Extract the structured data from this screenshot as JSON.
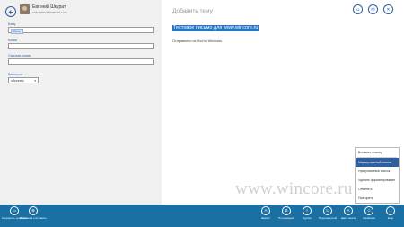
{
  "header": {
    "user_name": "Евгений Шкурат",
    "user_email": "shkuratev@hotmail.com"
  },
  "fields": {
    "to_label": "Кому",
    "to_chip": "Wins",
    "cc_label": "Копия",
    "bcc_label": "Скрытая копия",
    "priority_label": "Важность",
    "priority_value": "обычная"
  },
  "message": {
    "subject_placeholder": "Добавить тему",
    "body_text": "Тестовое письмо для www.wincore.ru",
    "signature": "Отправлено из Почты Windows"
  },
  "top_actions": {
    "attach_icon": "emoji-icon",
    "send_icon": "send-icon",
    "delete_icon": "delete-icon",
    "attach_glyph": "☺",
    "send_glyph": "✉",
    "delete_glyph": "✕"
  },
  "context_menu": {
    "items": [
      "Вставить ссылку",
      "Маркированный список",
      "Нумерованный список",
      "Удалить форматирование",
      "Отменить",
      "Повторить"
    ],
    "active_index": 1
  },
  "watermark": "www.wincore.ru",
  "app_bar": {
    "left": [
      {
        "label": "Сохранить черновик",
        "icon": "save-icon",
        "glyph": "▭"
      },
      {
        "label": "Вложения и вставить",
        "icon": "attachment-icon",
        "glyph": "⊕"
      }
    ],
    "right": [
      {
        "label": "Шрифт",
        "icon": "font-icon",
        "glyph": "A"
      },
      {
        "label": "Полужирный",
        "icon": "bold-icon",
        "glyph": "B"
      },
      {
        "label": "Курсив",
        "icon": "italic-icon",
        "glyph": "I"
      },
      {
        "label": "Подчеркнутый",
        "icon": "underline-icon",
        "glyph": "U"
      },
      {
        "label": "Цвет текста",
        "icon": "text-color-icon",
        "glyph": "A"
      },
      {
        "label": "Смайлики",
        "icon": "emoticons-icon",
        "glyph": "☺"
      },
      {
        "label": "Еще",
        "icon": "more-icon",
        "glyph": "…"
      }
    ]
  },
  "colors": {
    "accent": "#1a6fa3",
    "highlight": "#2a74c4",
    "pane_bg": "#f0f0f0"
  }
}
